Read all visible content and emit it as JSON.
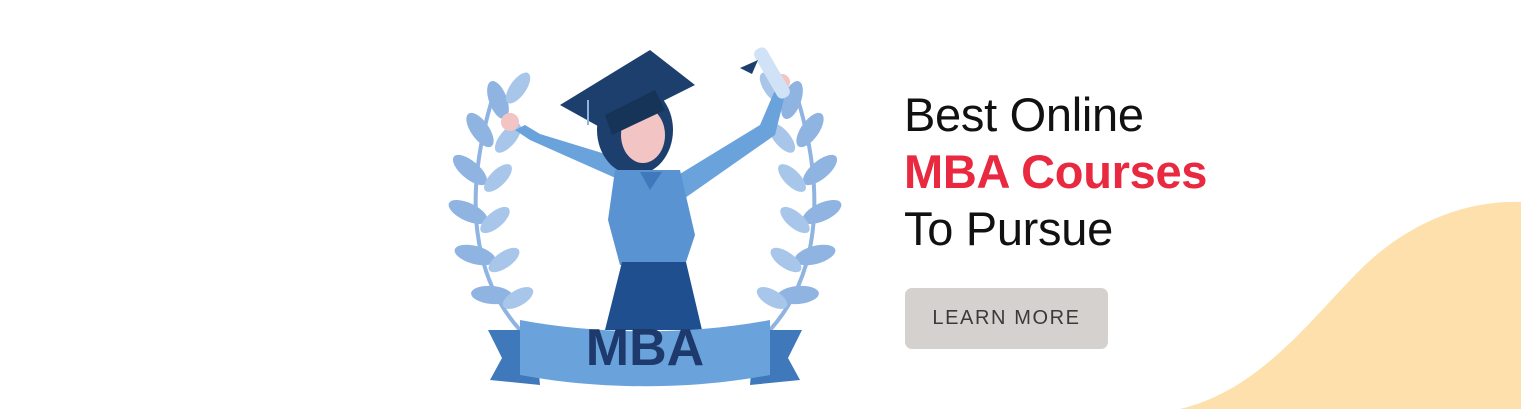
{
  "headline": {
    "line1": "Best Online",
    "line2": "MBA Courses",
    "line3": "To Pursue"
  },
  "cta": {
    "label": "LEARN MORE"
  },
  "illustration": {
    "ribbon_text": "MBA",
    "icon": "graduate-with-laurel-wreath"
  },
  "colors": {
    "accent": "#e8293f",
    "text": "#111111",
    "button_bg": "#d4d1cf",
    "button_text": "#3a3a3a",
    "wave": "#fde0ac",
    "ribbon_text": "#1e3a6d",
    "laurel": "#8fb4e2",
    "gown": "#5a93d2",
    "cap": "#1d3f6e"
  }
}
